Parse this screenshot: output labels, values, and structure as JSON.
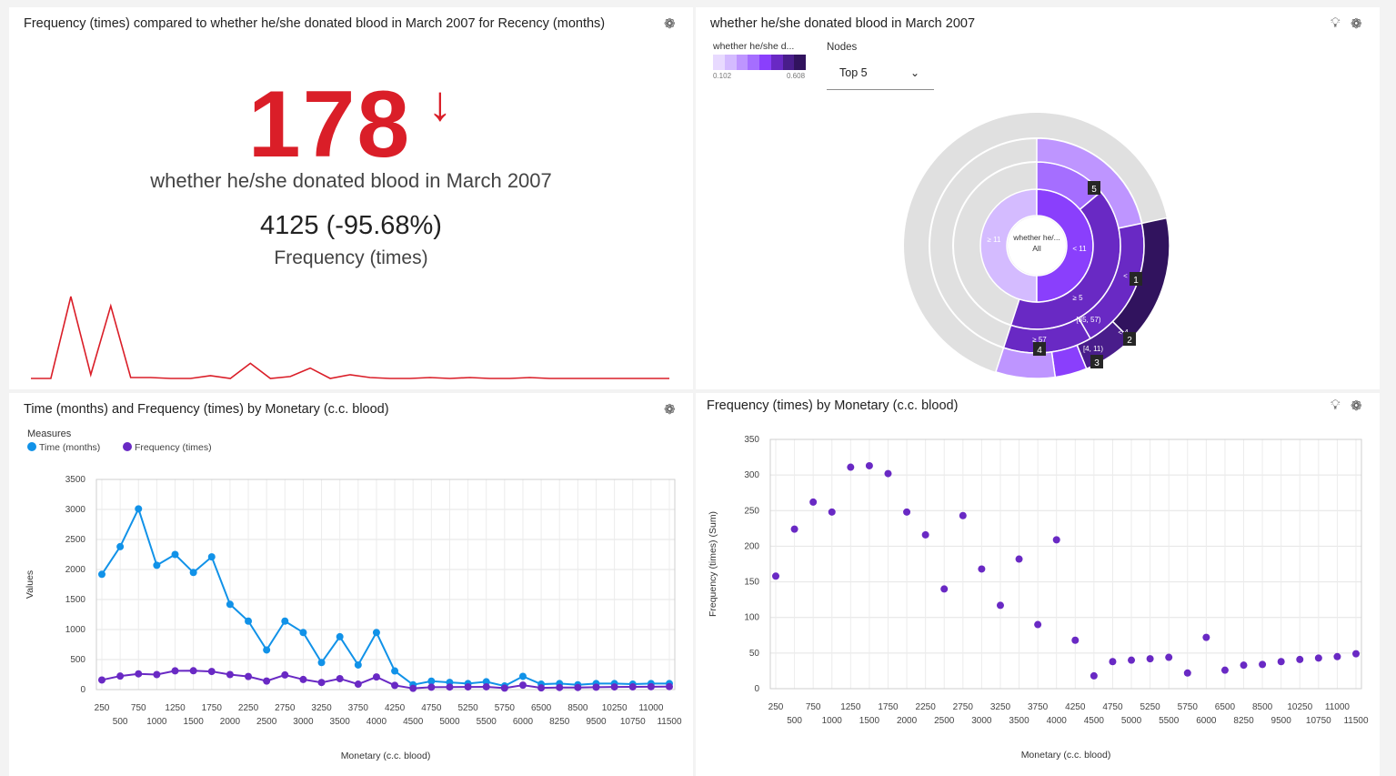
{
  "kpi": {
    "title": "Frequency (times) compared to whether he/she donated blood in March 2007 for Recency (months)",
    "value": "178",
    "trend_icon": "arrow-down-icon",
    "label": "whether he/she donated blood in March 2007",
    "comparison": "4125 (-95.68%)",
    "comparison_label": "Frequency (times)",
    "sparkline": [
      0,
      0,
      87,
      4,
      77,
      1,
      1,
      0,
      0,
      3,
      0,
      16,
      0,
      2,
      11,
      0,
      4,
      1,
      0,
      0,
      1,
      0,
      1,
      0,
      0,
      1,
      0,
      0,
      0,
      0,
      0,
      0,
      0
    ],
    "line_color": "#da1e28"
  },
  "sunburst": {
    "title": "whether he/she donated blood in March 2007",
    "legend_title": "whether he/she d...",
    "legend_min": "0.102",
    "legend_max": "0.608",
    "nodes_label": "Nodes",
    "nodes_value": "Top 5",
    "center_label": "whether he/...",
    "center_sub": "All",
    "ring_labels": [
      "≥ 11",
      "< 11",
      "≥ 5",
      "< 35",
      "[35, 57)",
      "≥ 57",
      "< 4",
      "[4, 11)"
    ],
    "badges": [
      "5",
      "1",
      "2",
      "3",
      "4"
    ],
    "colors": [
      "#e8daff",
      "#d4bbff",
      "#be95ff",
      "#a56eff",
      "#8a3ffc",
      "#6929c4",
      "#491d8b",
      "#31135e"
    ]
  },
  "line_panel": {
    "title": "Time (months) and Frequency (times) by Monetary (c.c. blood)",
    "measures_label": "Measures",
    "series_names": [
      "Time (months)",
      "Frequency (times)"
    ]
  },
  "scatter_panel": {
    "title": "Frequency (times) by Monetary (c.c. blood)"
  },
  "chart_data": [
    {
      "type": "line",
      "title": "Time (months) and Frequency (times) by Monetary (c.c. blood)",
      "xlabel": "Monetary (c.c. blood)",
      "ylabel": "Values",
      "ylim": [
        0,
        3500
      ],
      "yticks": [
        0,
        500,
        1000,
        1500,
        2000,
        2500,
        3000,
        3500
      ],
      "grid": true,
      "legend": "top-left",
      "categories": [
        "250",
        "500",
        "750",
        "1000",
        "1250",
        "1500",
        "1750",
        "2000",
        "2250",
        "2500",
        "2750",
        "3000",
        "3250",
        "3500",
        "3750",
        "4000",
        "4250",
        "4500",
        "4750",
        "5000",
        "5250",
        "5500",
        "5750",
        "6000",
        "6500",
        "8250",
        "8500",
        "9500",
        "10250",
        "10750",
        "11000",
        "11500"
      ],
      "series": [
        {
          "name": "Time (months)",
          "color": "#1192e8",
          "values": [
            1920,
            2380,
            3010,
            2070,
            2250,
            1950,
            2210,
            1420,
            1140,
            660,
            1140,
            950,
            450,
            880,
            410,
            950,
            310,
            80,
            140,
            120,
            100,
            130,
            60,
            220,
            90,
            100,
            80,
            100,
            100,
            90,
            100,
            100
          ]
        },
        {
          "name": "Frequency (times)",
          "color": "#6929c4",
          "values": [
            160,
            225,
            262,
            250,
            312,
            314,
            302,
            250,
            218,
            142,
            244,
            168,
            118,
            182,
            90,
            210,
            70,
            20,
            40,
            42,
            44,
            46,
            24,
            74,
            28,
            35,
            35,
            40,
            44,
            45,
            48,
            50
          ]
        }
      ]
    },
    {
      "type": "scatter",
      "title": "Frequency (times) by Monetary (c.c. blood)",
      "xlabel": "Monetary (c.c. blood)",
      "ylabel": "Frequency (times) (Sum)",
      "ylim": [
        0,
        350
      ],
      "yticks": [
        0,
        50,
        100,
        150,
        200,
        250,
        300,
        350
      ],
      "grid": true,
      "color": "#6929c4",
      "categories": [
        "250",
        "500",
        "750",
        "1000",
        "1250",
        "1500",
        "1750",
        "2000",
        "2250",
        "2500",
        "2750",
        "3000",
        "3250",
        "3500",
        "3750",
        "4000",
        "4250",
        "4500",
        "4750",
        "5000",
        "5250",
        "5500",
        "5750",
        "6000",
        "6500",
        "8250",
        "8500",
        "9500",
        "10250",
        "10750",
        "11000",
        "11500"
      ],
      "values": [
        158,
        224,
        262,
        248,
        311,
        313,
        302,
        248,
        216,
        140,
        243,
        168,
        117,
        182,
        90,
        209,
        68,
        18,
        38,
        40,
        42,
        44,
        22,
        72,
        26,
        33,
        34,
        38,
        41,
        43,
        45,
        49
      ]
    }
  ]
}
